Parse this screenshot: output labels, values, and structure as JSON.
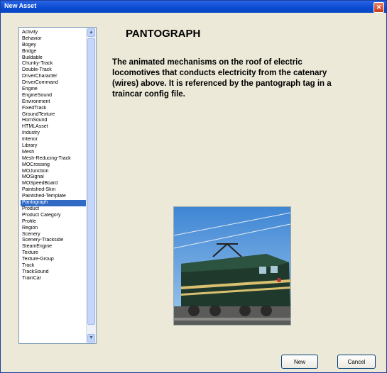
{
  "window": {
    "title": "New Asset",
    "close_glyph": "✕"
  },
  "list": {
    "items": [
      "Activity",
      "Behavior",
      "Bogey",
      "Bridge",
      "Buildable",
      "Chunky-Track",
      "Double-Track",
      "DriverCharacter",
      "DriverCommand",
      "Engine",
      "EngineSound",
      "Environment",
      "FixedTrack",
      "GroundTexture",
      "HornSound",
      "HTMLAsset",
      "Industry",
      "Interior",
      "Library",
      "Mesh",
      "Mesh-Reducing-Track",
      "MOCrossing",
      "MOJunction",
      "MOSignal",
      "MOSpeedBoard",
      "Paintshed-Skin",
      "Paintshed-Template",
      "Pantograph",
      "Product",
      "Product Category",
      "Profile",
      "Region",
      "Scenery",
      "Scenery-Trackside",
      "SteamEngine",
      "Texture",
      "Texture-Group",
      "Track",
      "TrackSound",
      "TrainCar"
    ],
    "selected_index": 27,
    "scroll_up_glyph": "▲",
    "scroll_down_glyph": "▼"
  },
  "detail": {
    "heading": "PANTOGRAPH",
    "description": "The animated mechanisms on the roof of electric locomotives that conducts electricity from the catenary (wires) above. It is referenced by the pantograph tag in a traincar config file."
  },
  "buttons": {
    "new_label": "New",
    "cancel_label": "Cancel"
  },
  "colors": {
    "title_bar": "#0a4ad0",
    "selection": "#316ac5",
    "dialog_bg": "#ece9d8"
  }
}
